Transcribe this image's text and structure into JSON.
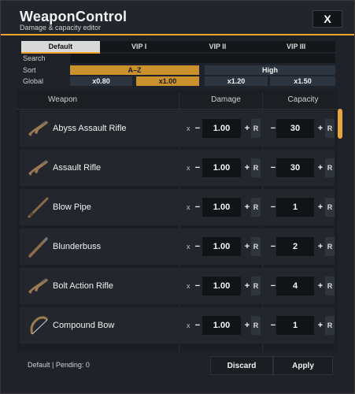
{
  "header": {
    "title": "WeaponControl",
    "subtitle": "Damage & capacity editor",
    "close_label": "X"
  },
  "tabs": [
    {
      "label": "Default",
      "active": true
    },
    {
      "label": "VIP I",
      "active": false
    },
    {
      "label": "VIP II",
      "active": false
    },
    {
      "label": "VIP III",
      "active": false
    }
  ],
  "options": {
    "search_label": "Search",
    "search_value": "",
    "sort_label": "Sort",
    "sort_options": [
      {
        "label": "A–Z",
        "selected": true
      },
      {
        "label": "High",
        "selected": false
      }
    ],
    "global_label": "Global",
    "global_options": [
      {
        "label": "x0.80",
        "selected": false
      },
      {
        "label": "x1.00",
        "selected": true
      },
      {
        "label": "x1.20",
        "selected": false
      },
      {
        "label": "x1.50",
        "selected": false
      }
    ]
  },
  "table": {
    "headers": {
      "weapon": "Weapon",
      "damage": "Damage",
      "capacity": "Capacity"
    },
    "x_label": "x",
    "minus": "−",
    "plus": "+",
    "reset": "R",
    "rows": [
      {
        "name": "Abyss Assault Rifle",
        "damage": "1.00",
        "capacity": "30",
        "icon": "rifle-icon"
      },
      {
        "name": "Assault Rifle",
        "damage": "1.00",
        "capacity": "30",
        "icon": "rifle-icon"
      },
      {
        "name": "Blow Pipe",
        "damage": "1.00",
        "capacity": "1",
        "icon": "blowpipe-icon"
      },
      {
        "name": "Blunderbuss",
        "damage": "1.00",
        "capacity": "2",
        "icon": "shotgun-icon"
      },
      {
        "name": "Bolt Action Rifle",
        "damage": "1.00",
        "capacity": "4",
        "icon": "rifle-icon"
      },
      {
        "name": "Compound Bow",
        "damage": "1.00",
        "capacity": "1",
        "icon": "bow-icon"
      }
    ]
  },
  "footer": {
    "status": "Default | Pending: 0",
    "discard_label": "Discard",
    "apply_label": "Apply"
  },
  "colors": {
    "accent": "#f0a52a",
    "panel": "#1f2329",
    "row": "#23272d"
  }
}
